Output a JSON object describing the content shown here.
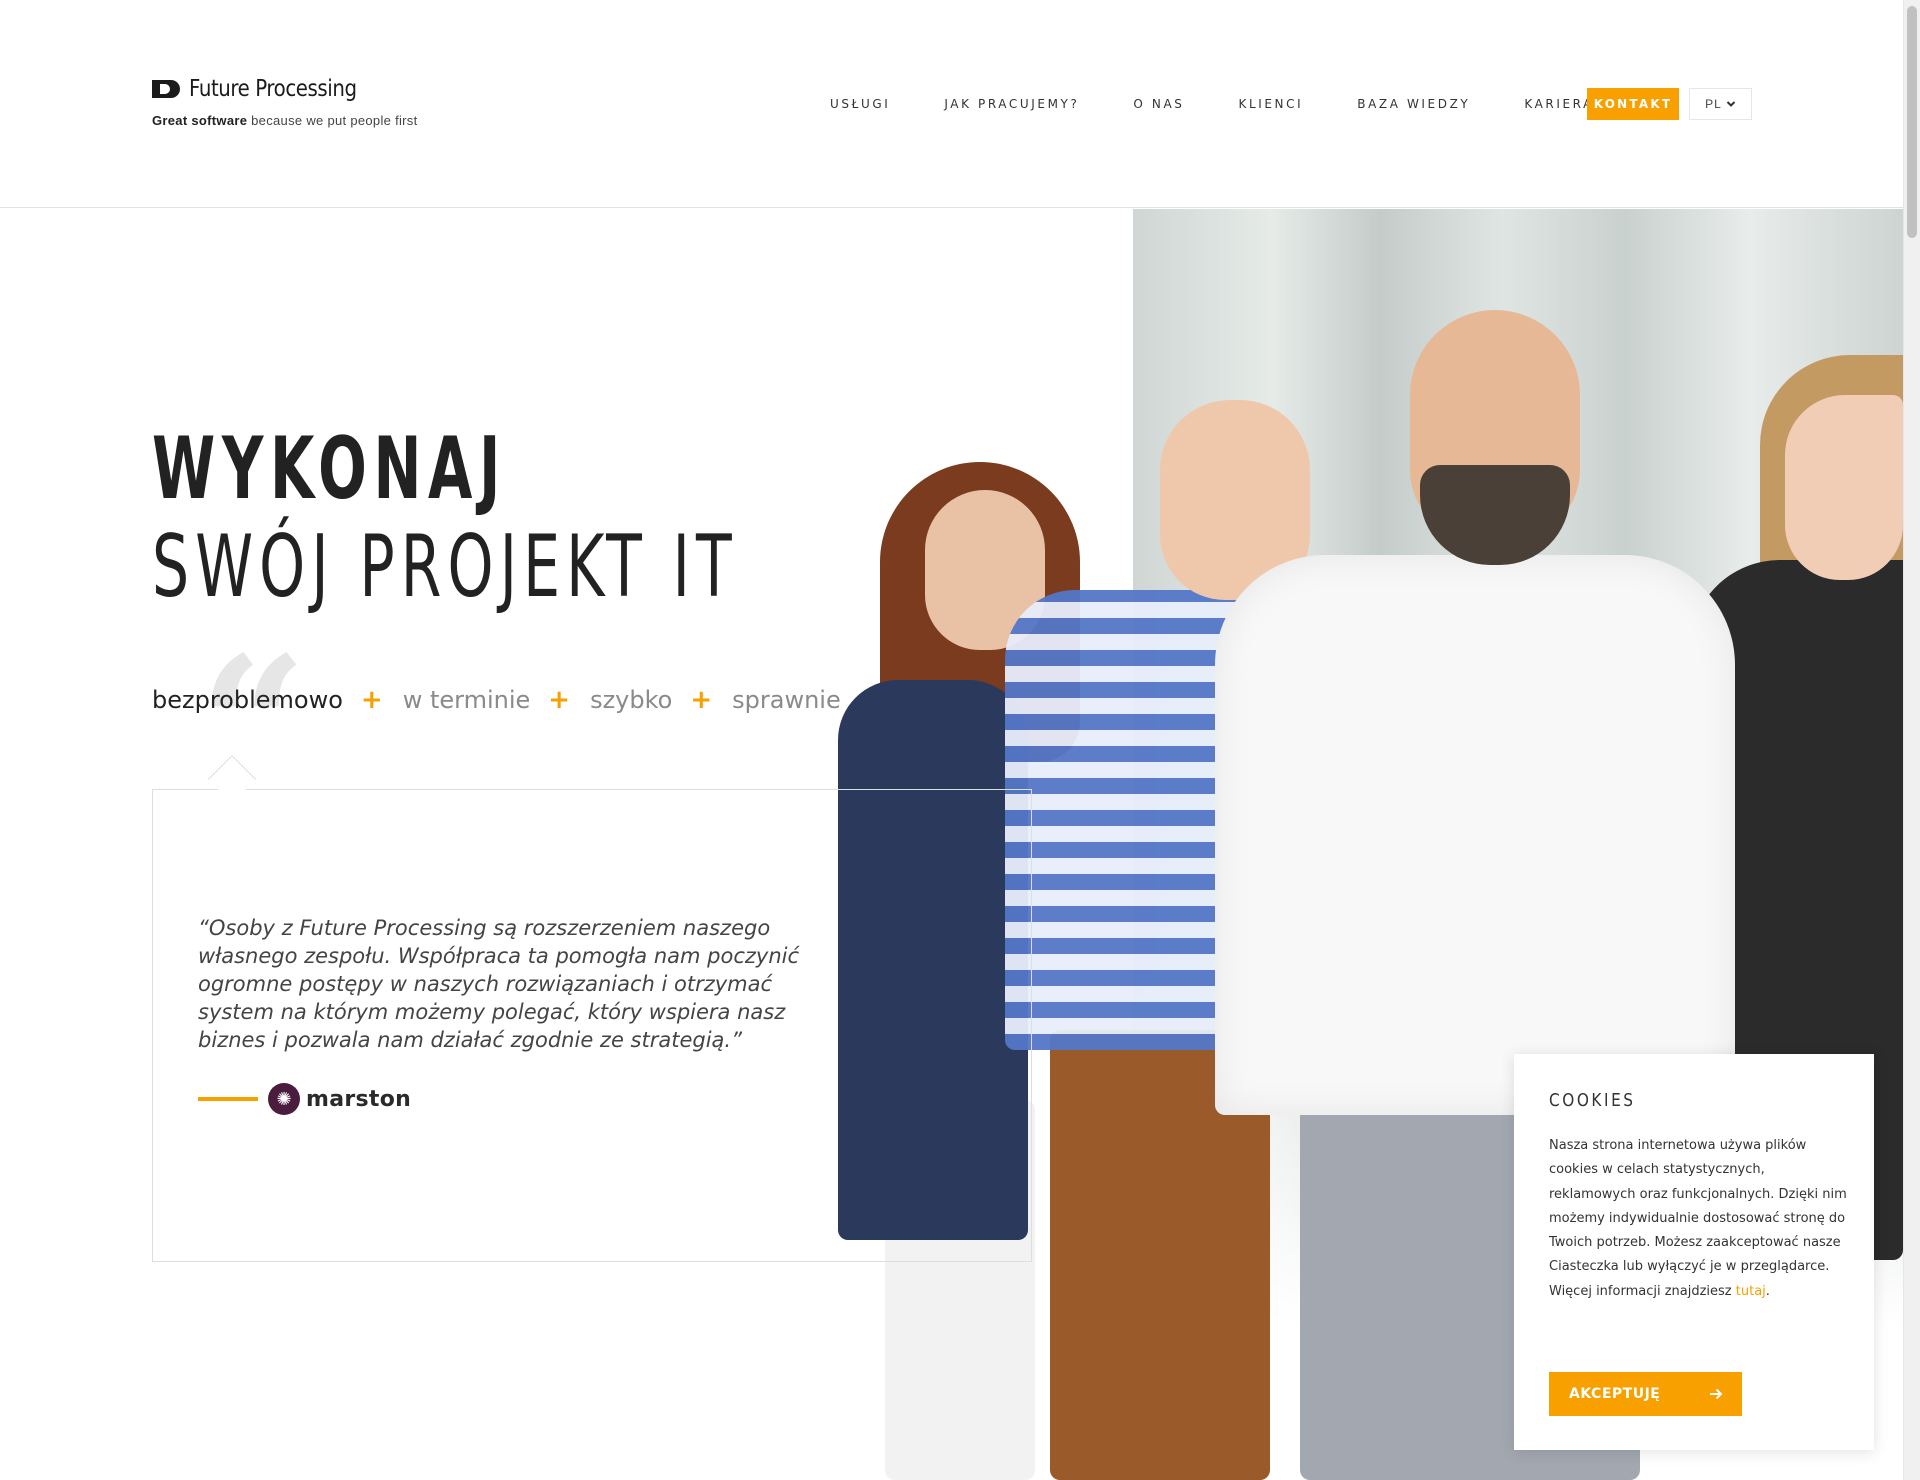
{
  "brand": {
    "name": "Future Processing",
    "tagline_bold": "Great software",
    "tagline_rest": "because we put people first"
  },
  "nav": {
    "items": [
      "USŁUGI",
      "JAK PRACUJEMY?",
      "O NAS",
      "KLIENCI",
      "BAZA WIEDZY",
      "KARIERA"
    ],
    "cta": "KONTAKT",
    "language": "PL"
  },
  "hero": {
    "line1": "WYKONAJ",
    "line2": "SWÓJ PROJEKT IT",
    "words": [
      "bezproblemowo",
      "w terminie",
      "szybko",
      "sprawnie"
    ],
    "active_word_index": 0
  },
  "testimonial": {
    "quote": "“Osoby z Future Processing są rozszerzeniem naszego własnego zespołu. Współpraca ta pomogła nam poczynić ogromne postępy w naszych rozwiązaniach i otrzymać system na którym możemy polegać, który wspiera nasz biznes i pozwala nam działać zgodnie ze strategią.”",
    "client": "marston"
  },
  "cookies": {
    "title": "COOKIES",
    "text": "Nasza strona internetowa używa plików cookies w celach statystycznych, reklamowych oraz funkcjonalnych. Dzięki nim możemy indywidualnie dostosować stronę do Twoich potrzeb. Możesz zaakceptować nasze Ciasteczka lub wyłączyć je w przeglądarce. Więcej informacji znajdziesz",
    "link": "tutaj",
    "end": ".",
    "button": "AKCEPTUJĘ"
  },
  "colors": {
    "accent": "#f7a000",
    "text": "#222222",
    "muted": "#8a8a8a"
  }
}
